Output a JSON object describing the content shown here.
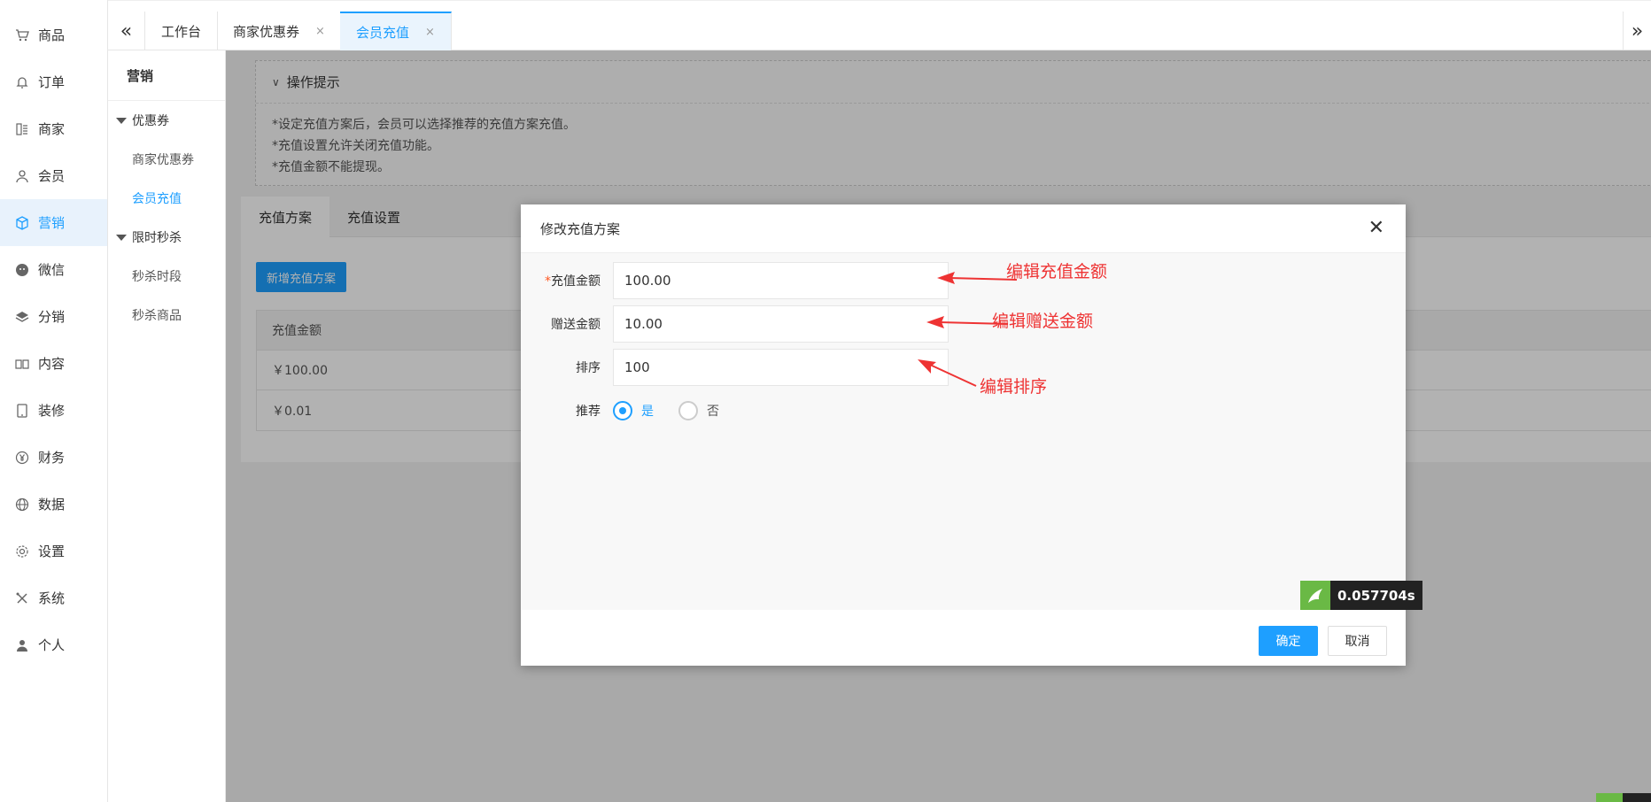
{
  "nav": {
    "items": [
      {
        "label": "商品",
        "icon": "cart-icon"
      },
      {
        "label": "订单",
        "icon": "bell-icon"
      },
      {
        "label": "商家",
        "icon": "store-icon"
      },
      {
        "label": "会员",
        "icon": "user-icon"
      },
      {
        "label": "营销",
        "icon": "cube-icon"
      },
      {
        "label": "微信",
        "icon": "wechat-icon"
      },
      {
        "label": "分销",
        "icon": "layers-icon"
      },
      {
        "label": "内容",
        "icon": "book-icon"
      },
      {
        "label": "装修",
        "icon": "tablet-icon"
      },
      {
        "label": "财务",
        "icon": "yen-icon"
      },
      {
        "label": "数据",
        "icon": "globe-icon"
      },
      {
        "label": "设置",
        "icon": "gear-icon"
      },
      {
        "label": "系统",
        "icon": "tools-icon"
      },
      {
        "label": "个人",
        "icon": "person-icon"
      }
    ],
    "active_index": 4
  },
  "topbar": {
    "tabs": [
      {
        "label": "工作台"
      },
      {
        "label": "商家优惠券"
      },
      {
        "label": "会员充值"
      }
    ],
    "close_glyph": "×"
  },
  "subnav": {
    "title": "营销",
    "group1": "优惠券",
    "group1_items": [
      "商家优惠券",
      "会员充值"
    ],
    "group2": "限时秒杀",
    "group2_items": [
      "秒杀时段",
      "秒杀商品"
    ]
  },
  "tips": {
    "title": "操作提示",
    "lines": [
      "*设定充值方案后，会员可以选择推荐的充值方案充值。",
      "*充值设置允许关闭充值功能。",
      "*充值金额不能提现。"
    ]
  },
  "panel": {
    "tabs": [
      "充值方案",
      "充值设置"
    ],
    "add_button": "新增充值方案",
    "table": {
      "header": "充值金额",
      "rows": [
        "￥100.00",
        "￥0.01"
      ]
    }
  },
  "modal": {
    "title": "修改充值方案",
    "close": "✕",
    "required_mark": "*",
    "fields": {
      "amount_label": "充值金额",
      "amount_value": "100.00",
      "bonus_label": "赠送金额",
      "bonus_value": "10.00",
      "sort_label": "排序",
      "sort_value": "100",
      "recommend_label": "推荐",
      "recommend_yes": "是",
      "recommend_no": "否"
    },
    "annotations": [
      "编辑充值金额",
      "编辑赠送金额",
      "编辑排序"
    ],
    "timer": "0.057704s",
    "ok": "确定",
    "cancel": "取消"
  },
  "colors": {
    "accent": "#1e9fff",
    "annotation": "#ee3333"
  }
}
